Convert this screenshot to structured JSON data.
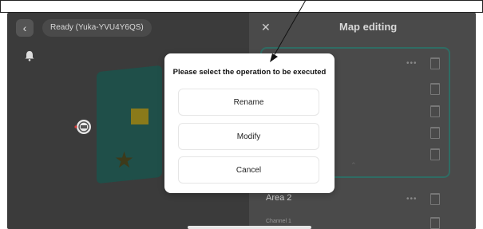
{
  "header": {
    "status_label": "Ready  (Yuka-YVU4Y6QS)"
  },
  "panel": {
    "title": "Map editing",
    "area2_label": "Area 2",
    "channel_label": "Channel 1"
  },
  "dialog": {
    "title": "Please select the operation to be executed",
    "buttons": [
      "Rename",
      "Modify",
      "Cancel"
    ]
  },
  "icons": {
    "back": "chevron-left-icon",
    "notify": "bell-icon",
    "close": "close-icon",
    "more": "more-dots-icon",
    "delete": "trash-icon",
    "collapse": "chevron-up-icon"
  },
  "colors": {
    "background": "#3b3b3b",
    "panel": "#4a4a4a",
    "accent_border": "#2f6c64",
    "map_fill": "#1f4f49",
    "dialog_bg": "#ffffff"
  }
}
